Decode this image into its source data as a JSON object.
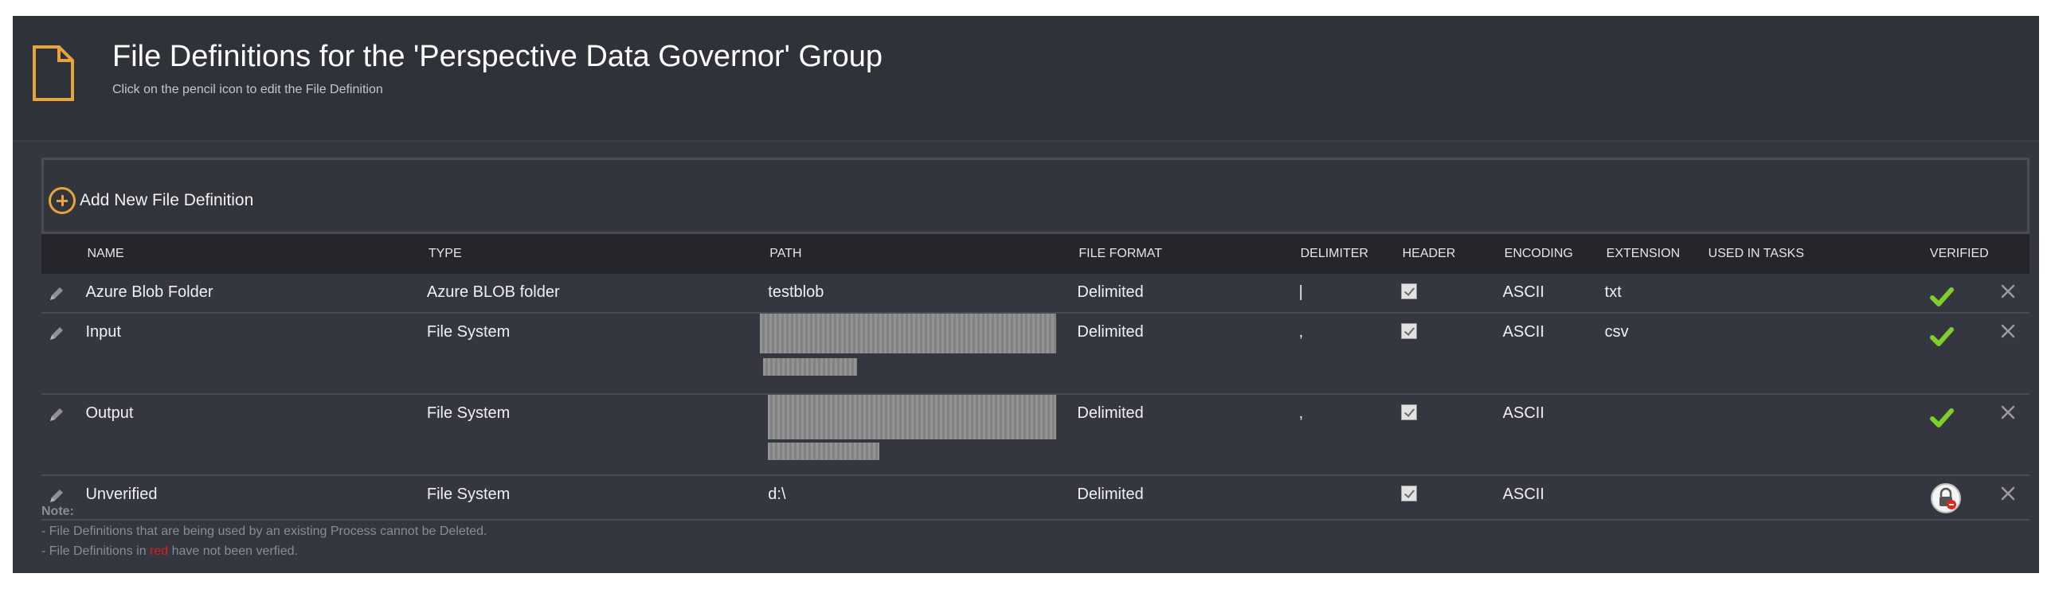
{
  "header": {
    "title": "File Definitions for the 'Perspective Data Governor' Group",
    "subtitle": "Click on the pencil icon to edit the File Definition",
    "icon": "document-icon",
    "accent_color": "#e8a33a"
  },
  "toolbar": {
    "add_label": "Add New File Definition",
    "add_icon": "add-circle-icon"
  },
  "table": {
    "columns": [
      "NAME",
      "TYPE",
      "PATH",
      "FILE FORMAT",
      "DELIMITER",
      "HEADER",
      "ENCODING",
      "EXTENSION",
      "USED IN TASKS",
      "VERIFIED"
    ],
    "rows": [
      {
        "name": "Azure Blob Folder",
        "type": "Azure BLOB folder",
        "path": "testblob",
        "format": "Delimited",
        "delimiter": "|",
        "header": true,
        "encoding": "ASCII",
        "extension": "txt",
        "used_in_tasks": "",
        "verified": true
      },
      {
        "name": "Input",
        "type": "File System",
        "path": "",
        "format": "Delimited",
        "delimiter": ",",
        "header": true,
        "encoding": "ASCII",
        "extension": "csv",
        "used_in_tasks": "",
        "verified": true
      },
      {
        "name": "Output",
        "type": "File System",
        "path": "",
        "format": "Delimited",
        "delimiter": ",",
        "header": true,
        "encoding": "ASCII",
        "extension": "",
        "used_in_tasks": "",
        "verified": true
      },
      {
        "name": "Unverified",
        "type": "File System",
        "path": "d:\\",
        "format": "Delimited",
        "delimiter": "",
        "header": true,
        "encoding": "ASCII",
        "extension": "",
        "used_in_tasks": "",
        "verified": false
      }
    ]
  },
  "notes": {
    "title": "Note:",
    "line1": "- File Definitions that are being used by an existing Process cannot be Deleted.",
    "line2_prefix": "- File Definitions in ",
    "line2_red": "red",
    "line2_suffix": " have not been verfied."
  },
  "colors": {
    "background": "#353740",
    "header_row": "#24262c",
    "unverified_text": "#ff2a2a",
    "verified_check": "#7fcf2a"
  }
}
